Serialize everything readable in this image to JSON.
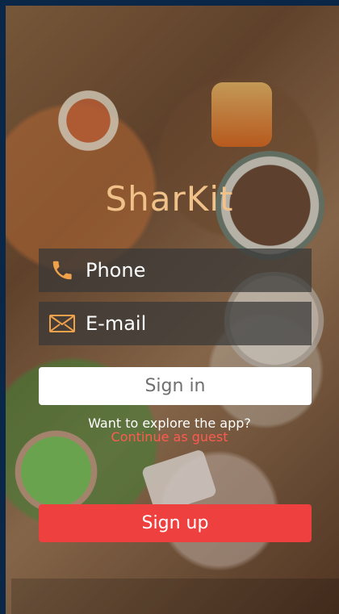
{
  "app": {
    "title": "SharKit"
  },
  "form": {
    "phone_label": "Phone",
    "email_label": "E-mail",
    "signin_label": "Sign in",
    "explore_text": "Want to explore the app?",
    "guest_link": "Continue as guest",
    "signup_label": "Sign up"
  },
  "icons": {
    "phone": "phone-icon",
    "email": "mail-icon"
  },
  "colors": {
    "title": "#f0c28a",
    "link": "#ff5a50",
    "signup": "#ef4040",
    "field_bg": "#373737"
  }
}
